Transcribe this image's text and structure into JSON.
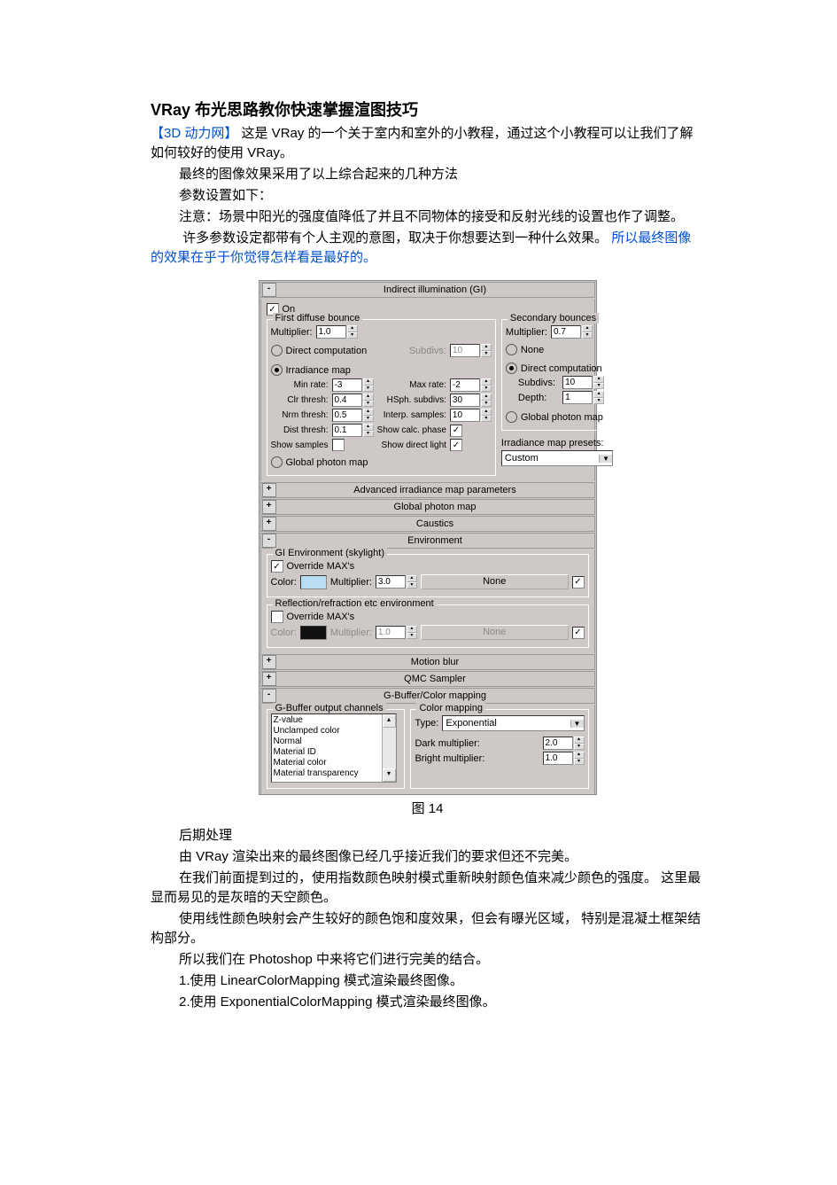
{
  "title": "VRay 布光思路教你快速掌握渲图技巧",
  "intro": {
    "p1a": "【3D 动力网】",
    "p1b": "这是 VRay 的一个关于室内和室外的小教程，通过这个小教程可以让我们了解如何较好的使用 VRay。",
    "p2": "最终的图像效果采用了以上综合起来的几种方法",
    "p3": "参数设置如下：",
    "p4": "注意：场景中阳光的强度值降低了并且不同物体的接受和反射光线的设置也作了调整。",
    "p5a": "许多参数设定都带有个人主观的意图，取决于你想要达到一种什么效果。",
    "p5b": "所以最终图像的效果在乎于你觉得怎样看是最好的。"
  },
  "gi": {
    "header": "Indirect illumination (GI)",
    "on": true,
    "on_label": "On",
    "first": {
      "legend": "First diffuse bounce",
      "multiplier_label": "Multiplier:",
      "multiplier": "1.0",
      "direct_label": "Direct computation",
      "subdivs_label": "Subdivs:",
      "subdivs": "10",
      "irr_label": "Irradiance map",
      "min_rate_label": "Min rate:",
      "min_rate": "-3",
      "max_rate_label": "Max rate:",
      "max_rate": "-2",
      "clr_label": "Clr thresh:",
      "clr": "0.4",
      "hsph_label": "HSph. subdivs:",
      "hsph": "30",
      "nrm_label": "Nrm thresh:",
      "nrm": "0.5",
      "interp_label": "Interp. samples:",
      "interp": "10",
      "dist_label": "Dist thresh:",
      "dist": "0.1",
      "calc_label": "Show calc. phase",
      "calc": true,
      "samples_label": "Show samples",
      "samples": false,
      "direct_light_label": "Show direct light",
      "direct_light": true,
      "gpm_label": "Global photon map"
    },
    "second": {
      "legend": "Secondary bounces",
      "multiplier_label": "Multiplier:",
      "multiplier": "0.7",
      "none_label": "None",
      "direct_label": "Direct computation",
      "subdivs_label": "Subdivs:",
      "subdivs": "10",
      "depth_label": "Depth:",
      "depth": "1",
      "gpm_label": "Global photon map",
      "presets_label": "Irradiance map presets:",
      "preset": "Custom"
    }
  },
  "rollouts": {
    "advanced": "Advanced irradiance map parameters",
    "gpm": "Global photon map",
    "caustics": "Caustics",
    "env": "Environment",
    "motion": "Motion blur",
    "qmc": "QMC Sampler",
    "gbuffer": "G-Buffer/Color mapping"
  },
  "env": {
    "gi_legend": "GI Environment (skylight)",
    "override_label": "Override MAX's",
    "gi_override": true,
    "color_label": "Color:",
    "multiplier_label": "Multiplier:",
    "gi_multiplier": "3.0",
    "none": "None",
    "refl_legend": "Reflection/refraction etc environment",
    "refl_override": false,
    "refl_multiplier": "1.0"
  },
  "gbuffer": {
    "channels_legend": "G-Buffer output channels",
    "items": [
      "Z-value",
      "Unclamped color",
      "Normal",
      "Material ID",
      "Material color",
      "Material transparency"
    ],
    "mapping_legend": "Color mapping",
    "type_label": "Type:",
    "type": "Exponential",
    "dark_label": "Dark multiplier:",
    "dark": "2.0",
    "bright_label": "Bright multiplier:",
    "bright": "1.0"
  },
  "caption": "图 14",
  "post": {
    "p1": "后期处理",
    "p2": "由 VRay 渲染出来的最终图像已经几乎接近我们的要求但还不完美。",
    "p3": "在我们前面提到过的，使用指数颜色映射模式重新映射颜色值来减少颜色的强度。 这里最显而易见的是灰暗的天空颜色。",
    "p4": "使用线性颜色映射会产生较好的颜色饱和度效果，但会有曝光区域， 特别是混凝土框架结构部分。",
    "p5": "所以我们在 Photoshop 中来将它们进行完美的结合。",
    "p6": "1.使用 LinearColorMapping 模式渲染最终图像。",
    "p7": "2.使用 ExponentialColorMapping 模式渲染最终图像。"
  }
}
